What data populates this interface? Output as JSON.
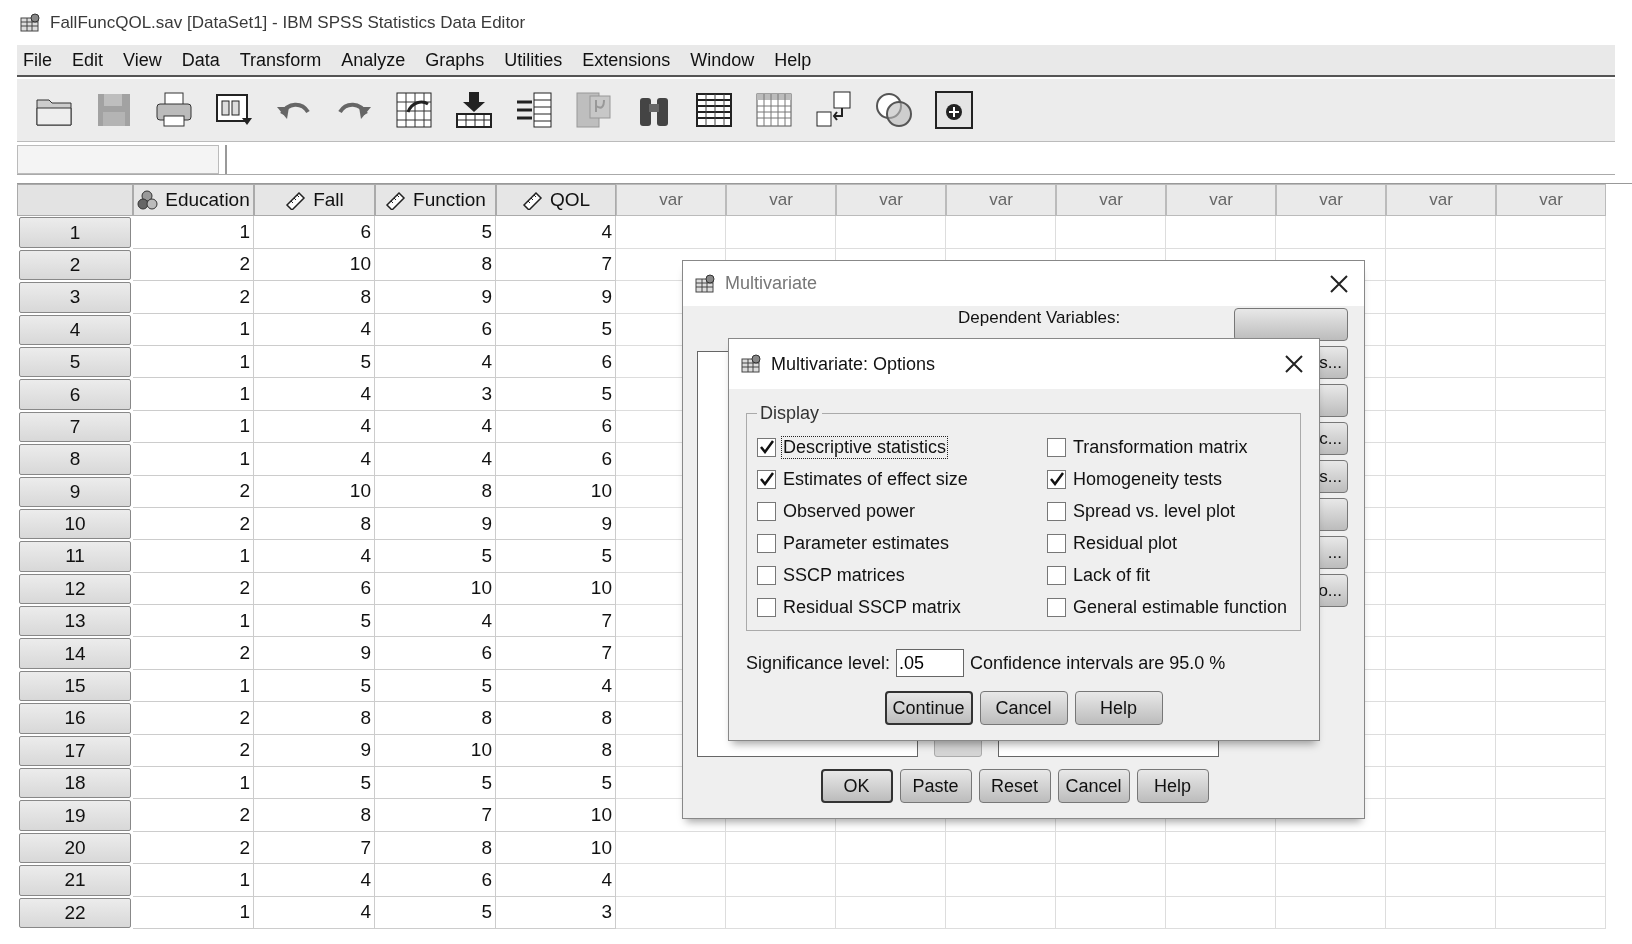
{
  "window": {
    "title": "FallFuncQOL.sav [DataSet1] - IBM SPSS Statistics Data Editor"
  },
  "menu": [
    "File",
    "Edit",
    "View",
    "Data",
    "Transform",
    "Analyze",
    "Graphs",
    "Utilities",
    "Extensions",
    "Window",
    "Help"
  ],
  "toolbar": [
    {
      "kind": "open",
      "disabled": false
    },
    {
      "kind": "save",
      "disabled": true
    },
    {
      "kind": "print",
      "disabled": false
    },
    {
      "kind": "recall",
      "disabled": false
    },
    {
      "kind": "undo",
      "disabled": false
    },
    {
      "kind": "redo",
      "disabled": false
    },
    {
      "kind": "goto-case",
      "disabled": false
    },
    {
      "kind": "goto-variable",
      "disabled": false
    },
    {
      "kind": "variables",
      "disabled": false
    },
    {
      "kind": "descriptives",
      "disabled": true
    },
    {
      "kind": "find",
      "disabled": false
    },
    {
      "kind": "insert-cases",
      "disabled": false
    },
    {
      "kind": "insert-variable",
      "disabled": false
    },
    {
      "kind": "value-labels",
      "disabled": false
    },
    {
      "kind": "use-sets",
      "disabled": false
    },
    {
      "kind": "show-all",
      "disabled": false
    }
  ],
  "columns": [
    {
      "name": "Education",
      "kind": "nominal"
    },
    {
      "name": "Fall",
      "kind": "scale"
    },
    {
      "name": "Function",
      "kind": "scale"
    },
    {
      "name": "QOL",
      "kind": "scale"
    }
  ],
  "empty_columns": [
    "var",
    "var",
    "var",
    "var",
    "var",
    "var",
    "var",
    "var",
    "var"
  ],
  "rows": [
    {
      "number": "1",
      "cells": [
        "1",
        "6",
        "5",
        "4"
      ]
    },
    {
      "number": "2",
      "cells": [
        "2",
        "10",
        "8",
        "7"
      ]
    },
    {
      "number": "3",
      "cells": [
        "2",
        "8",
        "9",
        "9"
      ]
    },
    {
      "number": "4",
      "cells": [
        "1",
        "4",
        "6",
        "5"
      ]
    },
    {
      "number": "5",
      "cells": [
        "1",
        "5",
        "4",
        "6"
      ]
    },
    {
      "number": "6",
      "cells": [
        "1",
        "4",
        "3",
        "5"
      ]
    },
    {
      "number": "7",
      "cells": [
        "1",
        "4",
        "4",
        "6"
      ]
    },
    {
      "number": "8",
      "cells": [
        "1",
        "4",
        "4",
        "6"
      ]
    },
    {
      "number": "9",
      "cells": [
        "2",
        "10",
        "8",
        "10"
      ]
    },
    {
      "number": "10",
      "cells": [
        "2",
        "8",
        "9",
        "9"
      ]
    },
    {
      "number": "11",
      "cells": [
        "1",
        "4",
        "5",
        "5"
      ]
    },
    {
      "number": "12",
      "cells": [
        "2",
        "6",
        "10",
        "10"
      ]
    },
    {
      "number": "13",
      "cells": [
        "1",
        "5",
        "4",
        "7"
      ]
    },
    {
      "number": "14",
      "cells": [
        "2",
        "9",
        "6",
        "7"
      ]
    },
    {
      "number": "15",
      "cells": [
        "1",
        "5",
        "5",
        "4"
      ]
    },
    {
      "number": "16",
      "cells": [
        "2",
        "8",
        "8",
        "8"
      ]
    },
    {
      "number": "17",
      "cells": [
        "2",
        "9",
        "10",
        "8"
      ]
    },
    {
      "number": "18",
      "cells": [
        "1",
        "5",
        "5",
        "5"
      ]
    },
    {
      "number": "19",
      "cells": [
        "2",
        "8",
        "7",
        "10"
      ]
    },
    {
      "number": "20",
      "cells": [
        "2",
        "7",
        "8",
        "10"
      ]
    },
    {
      "number": "21",
      "cells": [
        "1",
        "4",
        "6",
        "4"
      ]
    },
    {
      "number": "22",
      "cells": [
        "1",
        "4",
        "5",
        "3"
      ]
    }
  ],
  "multivariate": {
    "title": "Multivariate",
    "dependent_label": "Dependent Variables:",
    "side_buttons": [
      {
        "kind": "covered"
      },
      {
        "kind": "labelled",
        "label": "s..."
      },
      {
        "kind": "covered"
      },
      {
        "kind": "labelled",
        "label": "c..."
      },
      {
        "kind": "labelled",
        "label": "s..."
      },
      {
        "kind": "covered"
      },
      {
        "kind": "labelled",
        "label": "..."
      },
      {
        "kind": "labelled",
        "label": "o..."
      }
    ],
    "buttons": [
      {
        "label": "OK",
        "default": true
      },
      {
        "label": "Paste",
        "default": false
      },
      {
        "label": "Reset",
        "default": false
      },
      {
        "label": "Cancel",
        "default": false
      },
      {
        "label": "Help",
        "default": false
      }
    ]
  },
  "options": {
    "title": "Multivariate: Options",
    "group": "Display",
    "checkboxes": [
      {
        "label": "Descriptive statistics",
        "checked": true,
        "focused": true
      },
      {
        "label": "Transformation matrix",
        "checked": false,
        "focused": false
      },
      {
        "label": "Estimates of effect size",
        "checked": true,
        "focused": false
      },
      {
        "label": "Homogeneity tests",
        "checked": true,
        "focused": false
      },
      {
        "label": "Observed power",
        "checked": false,
        "focused": false
      },
      {
        "label": "Spread vs. level plot",
        "checked": false,
        "focused": false
      },
      {
        "label": "Parameter estimates",
        "checked": false,
        "focused": false
      },
      {
        "label": "Residual plot",
        "checked": false,
        "focused": false
      },
      {
        "label": "SSCP matrices",
        "checked": false,
        "focused": false
      },
      {
        "label": "Lack of fit",
        "checked": false,
        "focused": false
      },
      {
        "label": "Residual SSCP matrix",
        "checked": false,
        "focused": false
      },
      {
        "label": "General estimable function",
        "checked": false,
        "focused": false
      }
    ],
    "significance": {
      "label": "Significance level:",
      "value": ".05"
    },
    "confidence": "Confidence intervals are 95.0 %",
    "buttons": [
      {
        "label": "Continue",
        "default": true
      },
      {
        "label": "Cancel",
        "default": false
      },
      {
        "label": "Help",
        "default": false
      }
    ]
  }
}
